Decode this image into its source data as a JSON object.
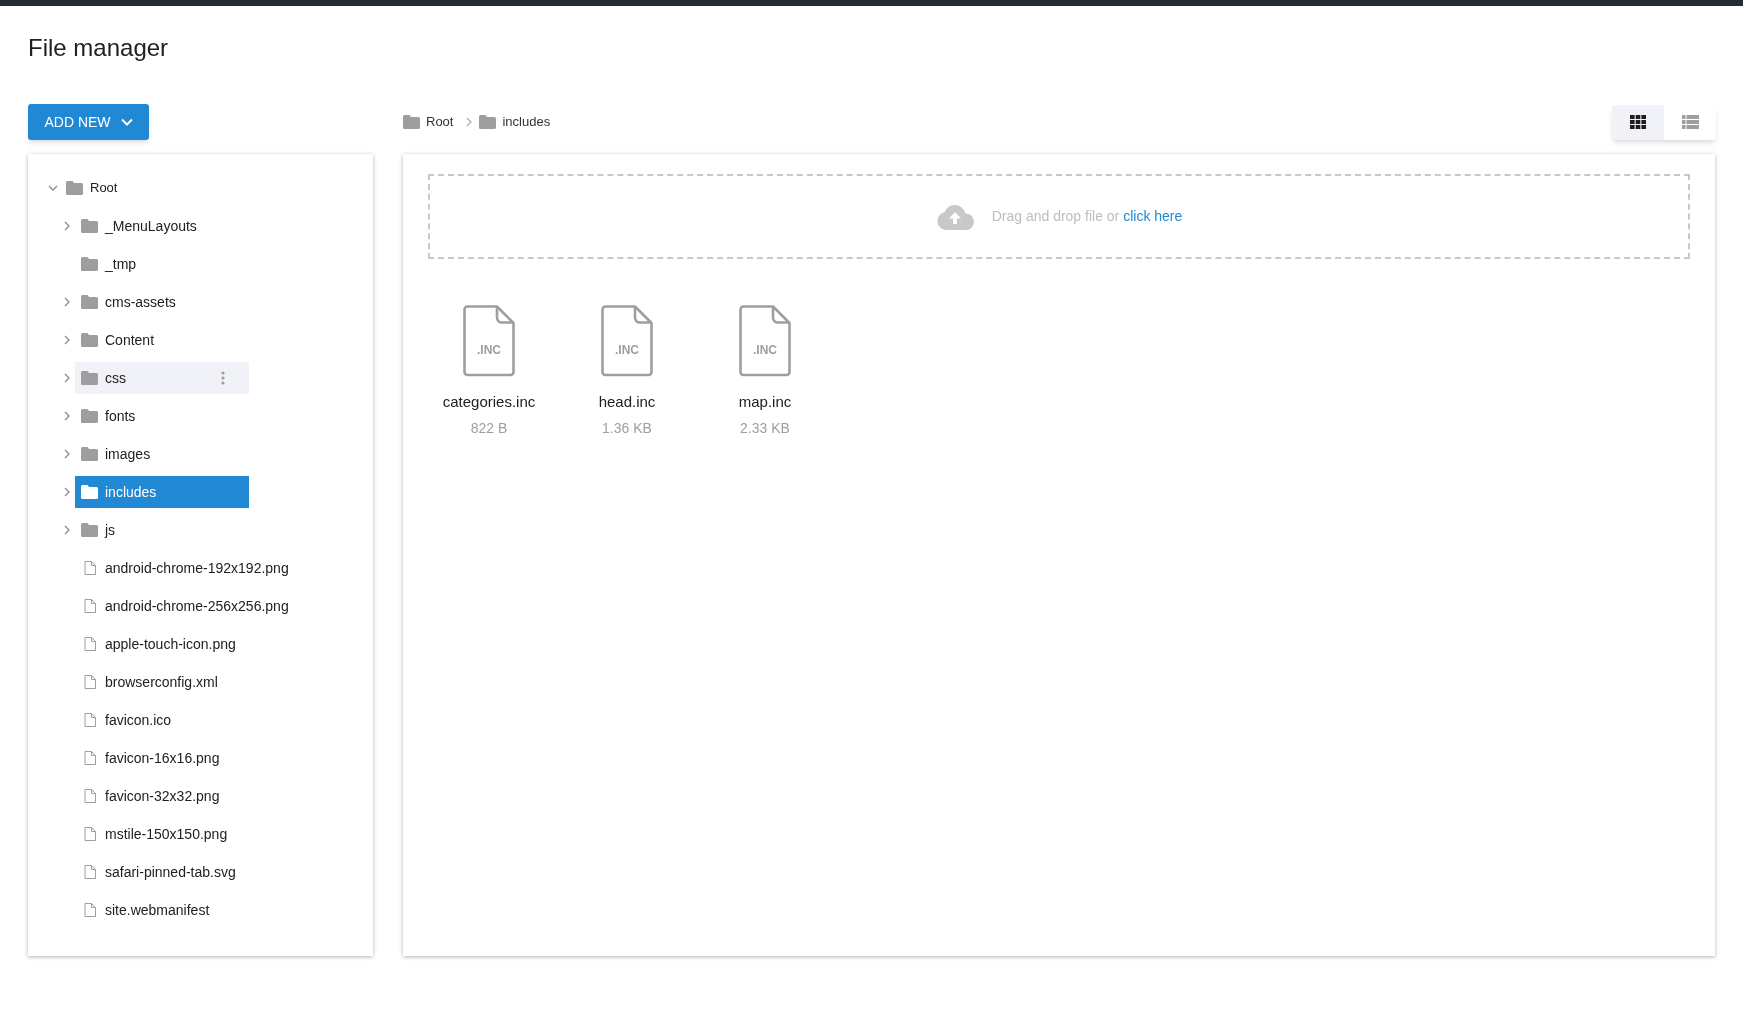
{
  "page_title": "File manager",
  "add_button": {
    "label": "ADD NEW"
  },
  "breadcrumb": [
    "Root",
    "includes"
  ],
  "view_toggle": [
    {
      "kind": "grid",
      "selected": true
    },
    {
      "kind": "list",
      "selected": false
    }
  ],
  "tree": {
    "label": "Root",
    "expanded": true,
    "children": [
      {
        "kind": "folder",
        "label": "_MenuLayouts",
        "expandable": true,
        "selected": false,
        "hovered": false
      },
      {
        "kind": "folder",
        "label": "_tmp",
        "expandable": false,
        "selected": false,
        "hovered": false
      },
      {
        "kind": "folder",
        "label": "cms-assets",
        "expandable": true,
        "selected": false,
        "hovered": false
      },
      {
        "kind": "folder",
        "label": "Content",
        "expandable": true,
        "selected": false,
        "hovered": false
      },
      {
        "kind": "folder",
        "label": "css",
        "expandable": true,
        "selected": false,
        "hovered": true
      },
      {
        "kind": "folder",
        "label": "fonts",
        "expandable": true,
        "selected": false,
        "hovered": false
      },
      {
        "kind": "folder",
        "label": "images",
        "expandable": true,
        "selected": false,
        "hovered": false
      },
      {
        "kind": "folder",
        "label": "includes",
        "expandable": true,
        "selected": true,
        "hovered": false
      },
      {
        "kind": "folder",
        "label": "js",
        "expandable": true,
        "selected": false,
        "hovered": false
      },
      {
        "kind": "file",
        "label": "android-chrome-192x192.png",
        "selected": false,
        "hovered": false
      },
      {
        "kind": "file",
        "label": "android-chrome-256x256.png",
        "selected": false,
        "hovered": false
      },
      {
        "kind": "file",
        "label": "apple-touch-icon.png",
        "selected": false,
        "hovered": false
      },
      {
        "kind": "file",
        "label": "browserconfig.xml",
        "selected": false,
        "hovered": false
      },
      {
        "kind": "file",
        "label": "favicon.ico",
        "selected": false,
        "hovered": false
      },
      {
        "kind": "file",
        "label": "favicon-16x16.png",
        "selected": false,
        "hovered": false
      },
      {
        "kind": "file",
        "label": "favicon-32x32.png",
        "selected": false,
        "hovered": false
      },
      {
        "kind": "file",
        "label": "mstile-150x150.png",
        "selected": false,
        "hovered": false
      },
      {
        "kind": "file",
        "label": "safari-pinned-tab.svg",
        "selected": false,
        "hovered": false
      },
      {
        "kind": "file",
        "label": "site.webmanifest",
        "selected": false,
        "hovered": false
      }
    ]
  },
  "dropzone": {
    "text": "Drag and drop file or",
    "link": "click here"
  },
  "files": [
    {
      "name": "categories.inc",
      "size": "822 B",
      "ext_label": ".INC"
    },
    {
      "name": "head.inc",
      "size": "1.36 KB",
      "ext_label": ".INC"
    },
    {
      "name": "map.inc",
      "size": "2.33 KB",
      "ext_label": ".INC"
    }
  ]
}
